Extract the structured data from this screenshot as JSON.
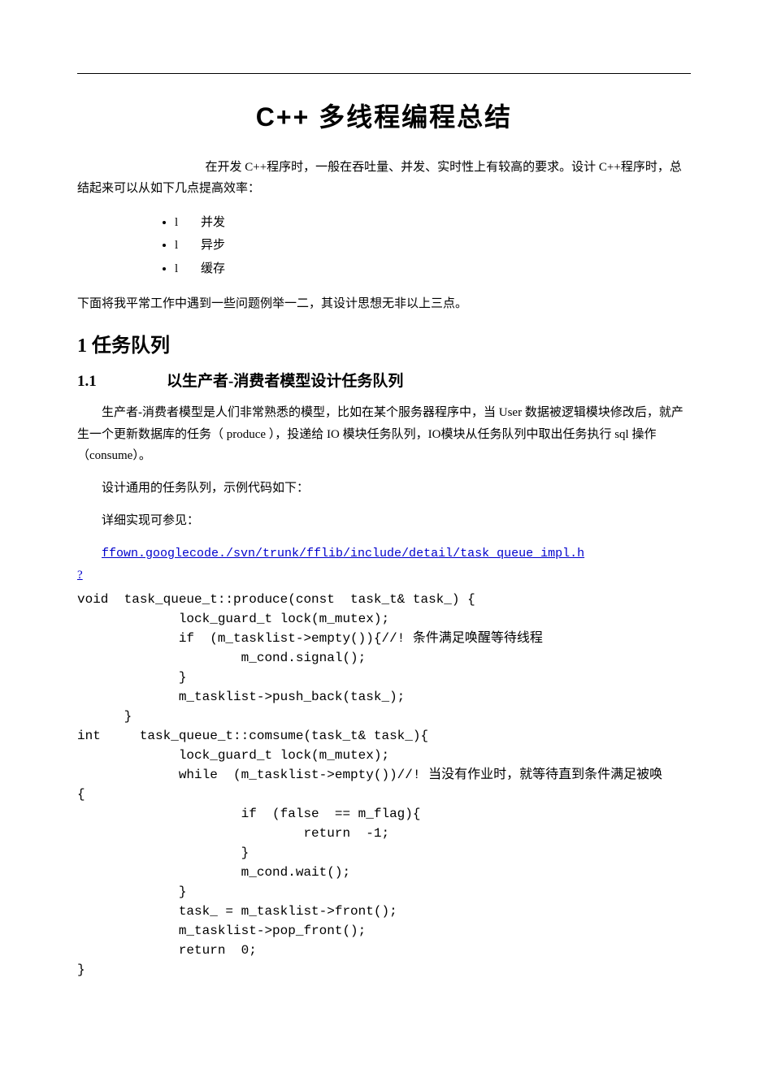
{
  "title": "C++ 多线程编程总结",
  "intro": "在开发 C++程序时，一般在吞吐量、并发、实时性上有较高的要求。设计 C++程序时，总结起来可以从如下几点提高效率：",
  "points": [
    {
      "num": "l",
      "label": "并发"
    },
    {
      "num": "l",
      "label": "异步"
    },
    {
      "num": "l",
      "label": "缓存"
    }
  ],
  "after_points": "下面将我平常工作中遇到一些问题例举一二，其设计思想无非以上三点。",
  "section1_heading": "1 任务队列",
  "section1_1_num": "1.1",
  "section1_1_title": "以生产者-消费者模型设计任务队列",
  "p1": "生产者-消费者模型是人们非常熟悉的模型，比如在某个服务器程序中，当 User 数据被逻辑模块修改后，就产生一个更新数据库的任务（ produce ），投递给 IO 模块任务队列，IO模块从任务队列中取出任务执行 sql 操作（consume）。",
  "p2": "设计通用的任务队列，示例代码如下：",
  "p3": "详细实现可参见：",
  "link_text": "ffown.googlecode./svn/trunk/fflib/include/detail/task_queue_impl.h",
  "link_q": "?",
  "code": "void  task_queue_t::produce(const  task_t& task_) {\n             lock_guard_t lock(m_mutex);\n             if  (m_tasklist->empty()){//! 条件满足唤醒等待线程\n                     m_cond.signal();\n             }\n             m_tasklist->push_back(task_);\n      }\nint     task_queue_t::comsume(task_t& task_){\n             lock_guard_t lock(m_mutex);\n             while  (m_tasklist->empty())//! 当没有作业时，就等待直到条件满足被唤\n{\n                     if  (false  == m_flag){\n                             return  -1;\n                     }\n                     m_cond.wait();\n             }\n             task_ = m_tasklist->front();\n             m_tasklist->pop_front();\n             return  0;\n}"
}
